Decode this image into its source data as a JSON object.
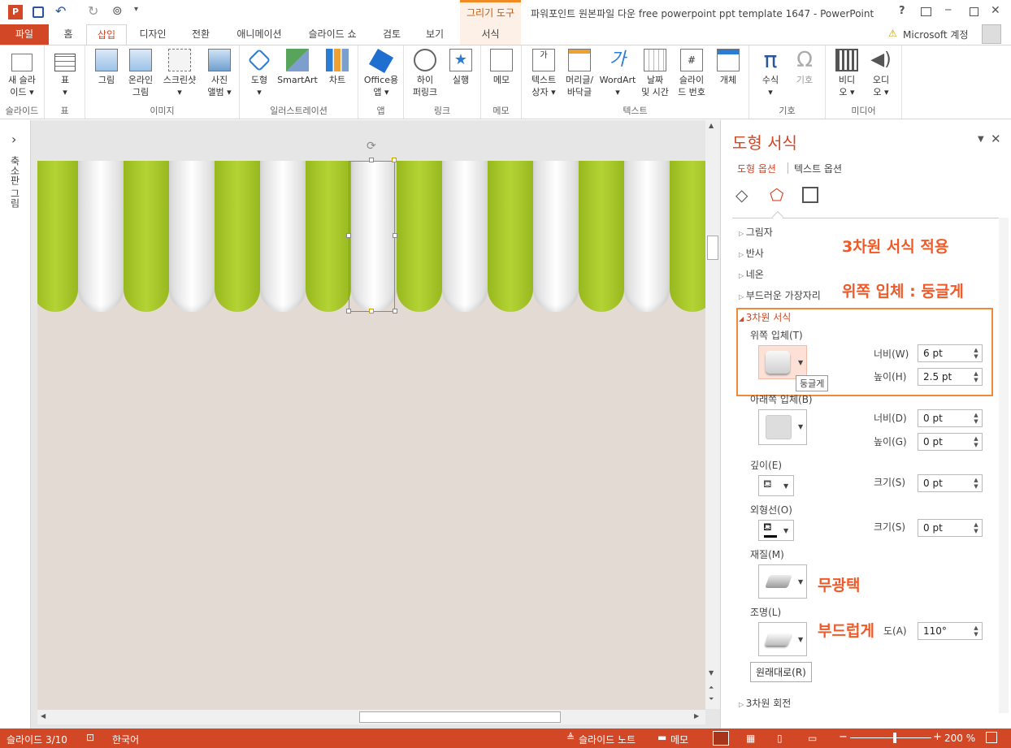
{
  "titlebar": {
    "title": "파워포인트 원본파일 다운 free powerpoint ppt template 1647 - PowerPoint",
    "context_tab": "그리기 도구",
    "help": "?",
    "minimize": "─",
    "close": "✕"
  },
  "tabs": {
    "file": "파일",
    "home": "홈",
    "insert": "삽입",
    "design": "디자인",
    "transitions": "전환",
    "animations": "애니메이션",
    "slideshow": "슬라이드 쇼",
    "review": "검토",
    "view": "보기",
    "format": "서식",
    "account": "Microsoft 계정"
  },
  "ribbon": {
    "slides": {
      "new_slide": "새 슬라\n이드 ▾",
      "label": "슬라이드"
    },
    "tables": {
      "table": "표\n▾",
      "label": "표"
    },
    "images": {
      "picture": "그림",
      "online": "온라인\n그림",
      "screenshot": "스크린샷\n▾",
      "album": "사진\n앨범 ▾",
      "label": "이미지"
    },
    "illustrations": {
      "shapes": "도형\n▾",
      "smartart": "SmartArt",
      "chart": "차트",
      "label": "일러스트레이션"
    },
    "apps": {
      "office": "Office용\n앱 ▾",
      "label": "앱"
    },
    "links": {
      "hyperlink": "하이\n퍼링크",
      "action": "실행",
      "label": "링크"
    },
    "comments": {
      "comment": "메모",
      "label": "메모"
    },
    "text": {
      "textbox": "텍스트\n상자 ▾",
      "header": "머리글/\n바닥글",
      "wordart": "WordArt\n▾",
      "datetime": "날짜\n및 시간",
      "slidenum": "슬라이\n드 번호",
      "object": "개체",
      "label": "텍스트"
    },
    "symbols": {
      "equation": "수식\n▾",
      "symbol": "기호",
      "label": "기호"
    },
    "media": {
      "video": "비디\n오 ▾",
      "audio": "오디\n오 ▾",
      "label": "미디어"
    }
  },
  "leftstrip": {
    "label": "축소판 그림",
    "arrow": "›"
  },
  "pane": {
    "title": "도형 서식",
    "tab_shape": "도형 옵션",
    "tab_text": "텍스트 옵션",
    "sections": {
      "shadow": "그림자",
      "reflection": "반사",
      "glow": "네온",
      "soft_edges": "부드러운 가장자리",
      "format3d": "3차원 서식",
      "rotation3d": "3차원 회전"
    },
    "top_bevel": "위쪽 입체(T)",
    "bottom_bevel": "아래쪽 입체(B)",
    "width_t": "너비(W)",
    "height_t": "높이(H)",
    "width_b": "너비(D)",
    "height_b": "높이(G)",
    "top_w": "6 pt",
    "top_h": "2.5 pt",
    "bot_w": "0 pt",
    "bot_h": "0 pt",
    "depth": "깊이(E)",
    "depth_size_label": "크기(S)",
    "depth_size": "0 pt",
    "contour": "외형선(O)",
    "contour_size_label": "크기(S)",
    "contour_size": "0 pt",
    "material": "재질(M)",
    "lighting": "조명(L)",
    "angle_suffix": "도(A)",
    "angle": "110°",
    "reset": "원래대로(R)",
    "tooltip": "둥글게"
  },
  "annotations": {
    "a1": "3차원 서식 적용",
    "a2": "위쪽 입체 : 둥글게",
    "a3": "무광택",
    "a4": "부드럽게"
  },
  "status": {
    "slide": "슬라이드 3/10",
    "lang": "한국어",
    "notes": "슬라이드 노트",
    "comments": "메모",
    "zoom": "200 %"
  },
  "colors": {
    "accent": "#d24726",
    "green": "#a8c82a",
    "slide_bg": "#e3dad4",
    "annotation": "#f05a28"
  }
}
